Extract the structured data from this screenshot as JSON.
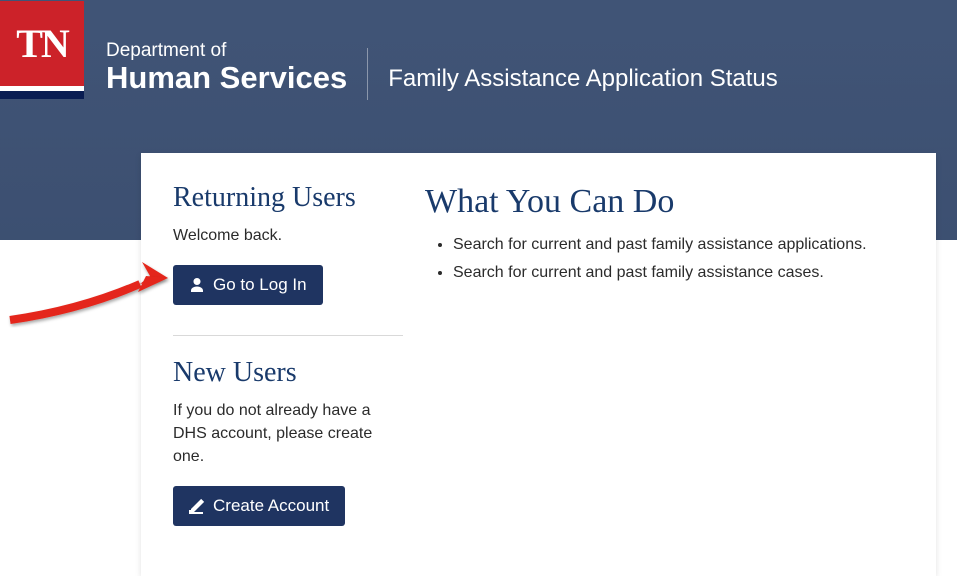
{
  "header": {
    "logo_text": "TN",
    "dept_small": "Department of",
    "dept_large": "Human Services",
    "page_title": "Family Assistance Application Status"
  },
  "returning": {
    "heading": "Returning Users",
    "welcome": "Welcome back.",
    "login_button": "Go to Log In"
  },
  "newusers": {
    "heading": "New Users",
    "instruction": "If you do not already have a DHS account, please create one.",
    "create_button": "Create Account"
  },
  "whatyoucando": {
    "heading": "What You Can Do",
    "bullets": [
      "Search for current and past family assistance applications.",
      "Search for current and past family assistance cases."
    ]
  }
}
